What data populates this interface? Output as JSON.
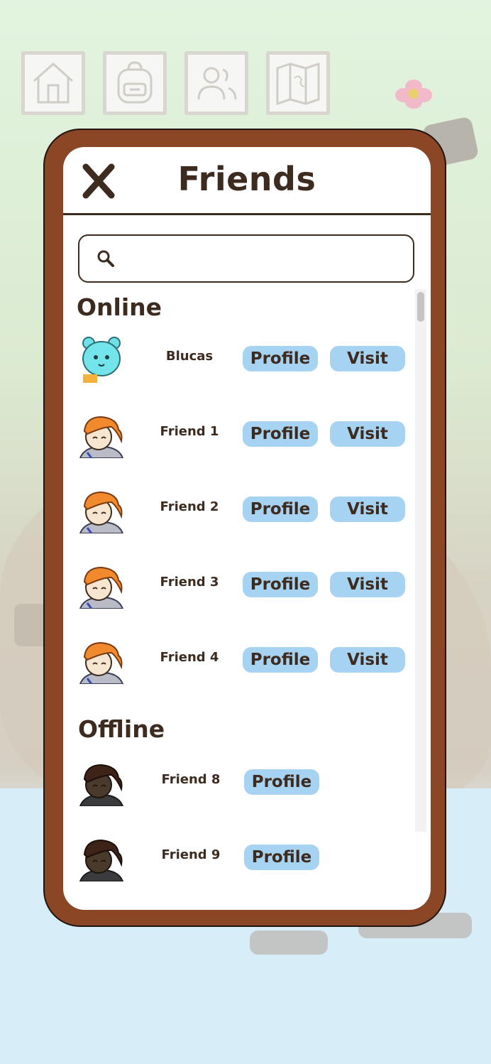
{
  "nav": {
    "icons": [
      "home-icon",
      "backpack-icon",
      "users-icon",
      "map-icon"
    ]
  },
  "panel": {
    "title": "Friends",
    "close_icon": "close-icon",
    "search": {
      "value": "",
      "placeholder": "",
      "icon": "search-icon"
    }
  },
  "sections": {
    "online": {
      "title": "Online",
      "friends": [
        {
          "name": "Blucas",
          "profile_label": "Profile",
          "visit_label": "Visit"
        },
        {
          "name": "Friend 1",
          "profile_label": "Profile",
          "visit_label": "Visit"
        },
        {
          "name": "Friend 2",
          "profile_label": "Profile",
          "visit_label": "Visit"
        },
        {
          "name": "Friend 3",
          "profile_label": "Profile",
          "visit_label": "Visit"
        },
        {
          "name": "Friend 4",
          "profile_label": "Profile",
          "visit_label": "Visit"
        }
      ]
    },
    "offline": {
      "title": "Offline",
      "friends": [
        {
          "name": "Friend 8",
          "profile_label": "Profile"
        },
        {
          "name": "Friend 9",
          "profile_label": "Profile"
        }
      ]
    }
  },
  "colors": {
    "frame": "#8b4725",
    "text": "#3d2b1f",
    "button": "#a7d3f2",
    "panel": "#ffffff"
  }
}
